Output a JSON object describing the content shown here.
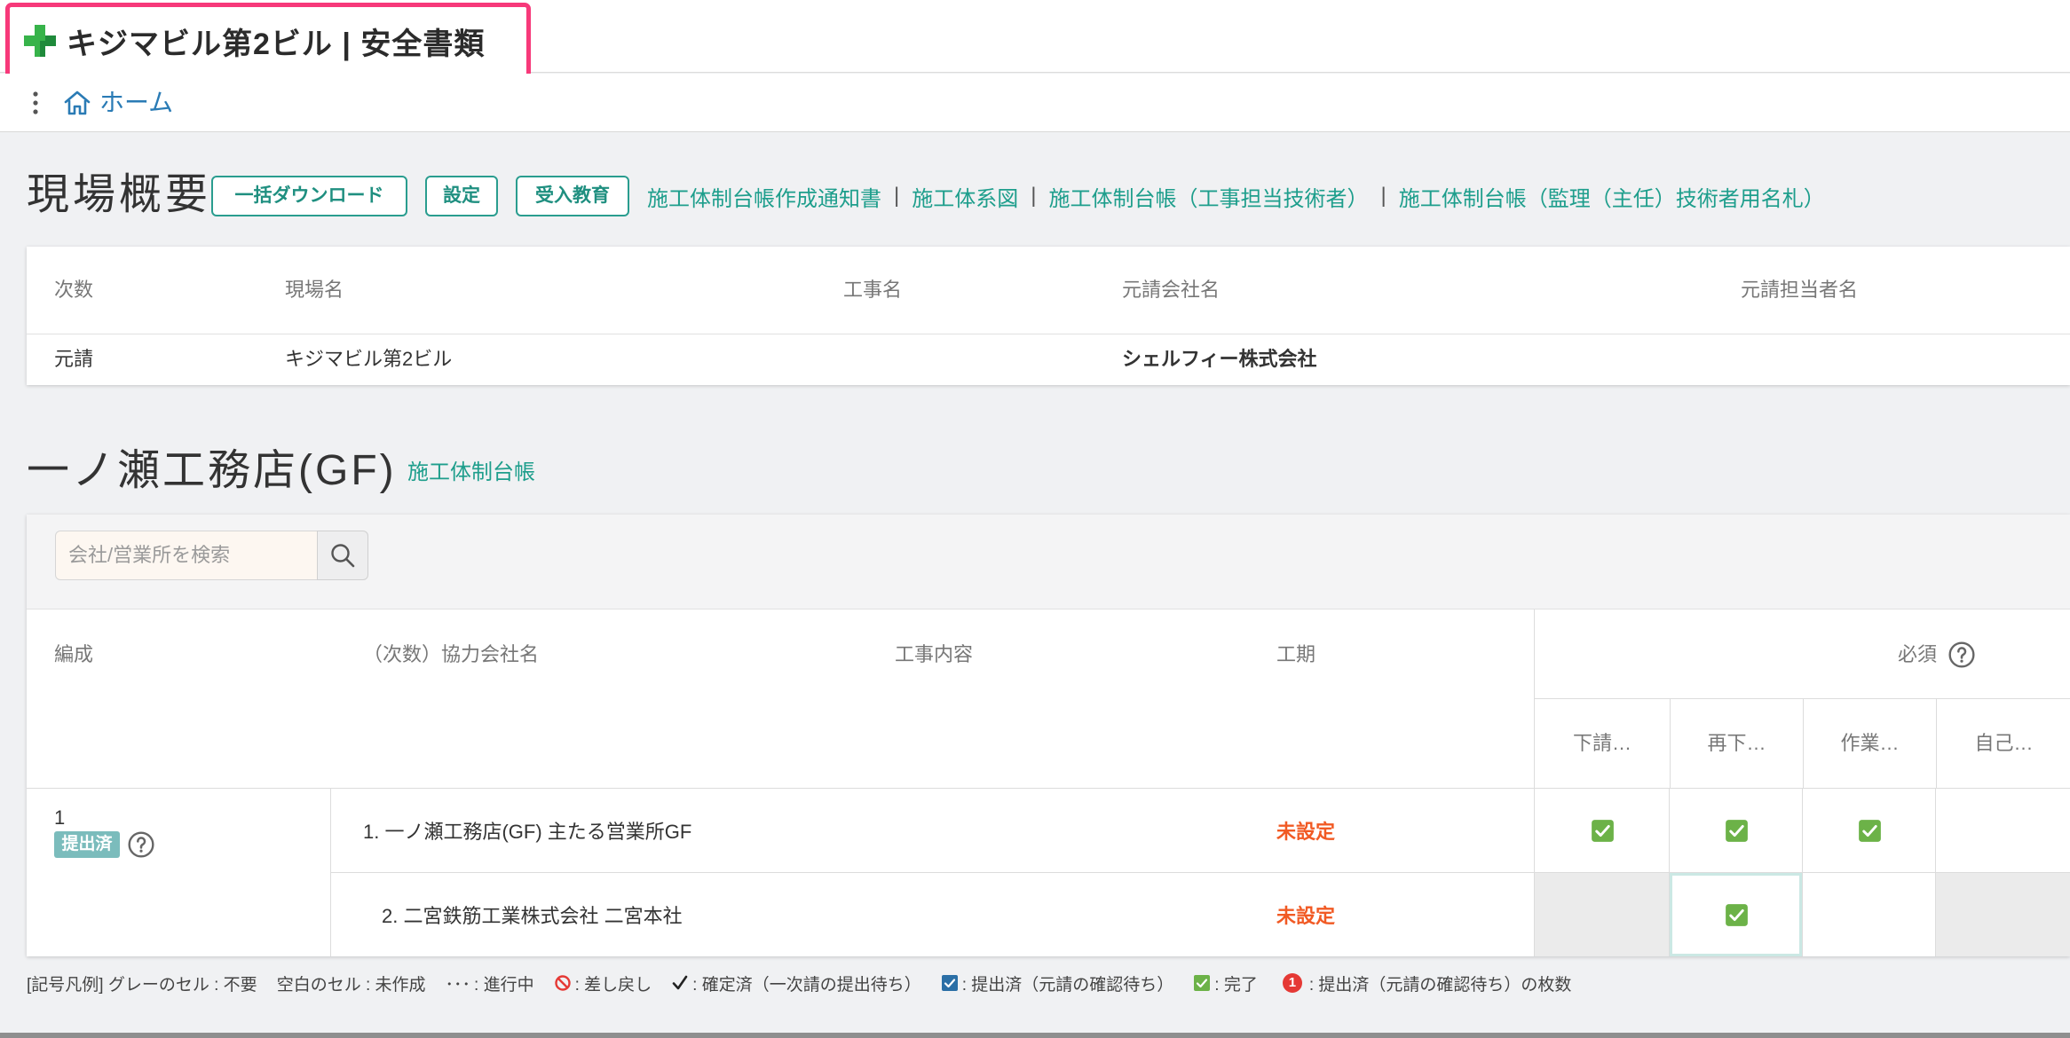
{
  "header": {
    "title": "キジマビル第2ビル | 安全書類",
    "icon": "green-cross-icon",
    "highlight_color": "#f7397a"
  },
  "breadcrumb": {
    "menu_icon": "vertical-dots-icon",
    "home_icon": "home-icon",
    "home_label": "ホーム"
  },
  "overview": {
    "title": "現場概要",
    "buttons": {
      "download": "一括ダウンロード",
      "settings": "設定",
      "education": "受入教育"
    },
    "separator": "|",
    "links": [
      "施工体制台帳作成通知書",
      "施工体系図",
      "施工体制台帳（工事担当技術者）",
      "施工体制台帳（監理（主任）技術者用名札）"
    ],
    "columns": {
      "tier": "次数",
      "site": "現場名",
      "work": "工事名",
      "contractor": "元請会社名",
      "manager": "元請担当者名"
    },
    "row": {
      "tier": "元請",
      "site": "キジマビル第2ビル",
      "work": "",
      "contractor": "シェルフィー株式会社",
      "manager": ""
    }
  },
  "company": {
    "title": "一ノ瀬工務店(GF)",
    "link": "施工体制台帳",
    "search": {
      "placeholder": "会社/営業所を検索",
      "value": "",
      "icon": "search-icon"
    },
    "columns": {
      "group": "編成",
      "name": "（次数）協力会社名",
      "content": "工事内容",
      "period": "工期"
    },
    "required": {
      "label": "必須",
      "icon": "help-circle-icon"
    },
    "doc_columns": [
      "下請…",
      "再下…",
      "作業…",
      "自己…"
    ],
    "group": {
      "number": "1",
      "status_badge": "提出済",
      "help_icon": "help-circle-icon"
    },
    "rows": [
      {
        "name": "1. 一ノ瀬工務店(GF) 主たる営業所GF",
        "content": "",
        "period": "未設定",
        "cells": [
          "done",
          "done",
          "done",
          "empty"
        ]
      },
      {
        "name": "2. 二宮鉄筋工業株式会社 二宮本社",
        "content": "",
        "period": "未設定",
        "cells": [
          "not-required",
          "done selected",
          "empty",
          "not-required"
        ]
      }
    ]
  },
  "legend": {
    "gray_cell": "[記号凡例] グレーのセル : 不要",
    "blank_cell": "空白のセル : 未作成",
    "in_progress_mark": "･･･",
    "in_progress": ":  進行中",
    "returned": ":  差し戻し",
    "confirmed": ":  確定済（一次請の提出待ち）",
    "submitted": ":  提出済（元請の確認待ち）",
    "completed": ":  完了",
    "count_mark": "1",
    "count": ": 提出済（元請の確認待ち）の枚数"
  },
  "colors": {
    "accent": "#1e9e8c",
    "link_blue": "#2a7bb5",
    "unset": "#f15a24",
    "done": "#6cb248",
    "submitted": "#2b6fa6",
    "returned": "#e53935",
    "not_required_cell": "#ebebeb",
    "badge": "#7bbcbc"
  }
}
